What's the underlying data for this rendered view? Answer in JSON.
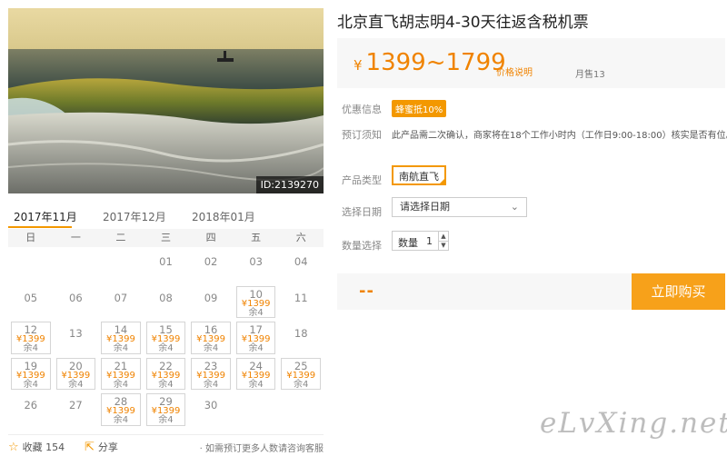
{
  "photo": {
    "id_label": "ID:2139270"
  },
  "calendar": {
    "tabs": [
      "2017年11月",
      "2017年12月",
      "2018年01月"
    ],
    "weekdays": [
      "日",
      "一",
      "二",
      "三",
      "四",
      "五",
      "六"
    ],
    "cells": [
      null,
      null,
      null,
      {
        "day": "01"
      },
      {
        "day": "02"
      },
      {
        "day": "03"
      },
      {
        "day": "04"
      },
      {
        "day": "05"
      },
      {
        "day": "06"
      },
      {
        "day": "07"
      },
      {
        "day": "08"
      },
      {
        "day": "09"
      },
      {
        "day": "10",
        "price": "¥1399",
        "rem": "余4"
      },
      {
        "day": "11"
      },
      {
        "day": "12",
        "price": "¥1399",
        "rem": "余4"
      },
      {
        "day": "13"
      },
      {
        "day": "14",
        "price": "¥1399",
        "rem": "余4"
      },
      {
        "day": "15",
        "price": "¥1399",
        "rem": "余4"
      },
      {
        "day": "16",
        "price": "¥1399",
        "rem": "余4"
      },
      {
        "day": "17",
        "price": "¥1399",
        "rem": "余4"
      },
      {
        "day": "18"
      },
      {
        "day": "19",
        "price": "¥1399",
        "rem": "余4"
      },
      {
        "day": "20",
        "price": "¥1399",
        "rem": "余4"
      },
      {
        "day": "21",
        "price": "¥1399",
        "rem": "余4"
      },
      {
        "day": "22",
        "price": "¥1399",
        "rem": "余4"
      },
      {
        "day": "23",
        "price": "¥1399",
        "rem": "余4"
      },
      {
        "day": "24",
        "price": "¥1399",
        "rem": "余4"
      },
      {
        "day": "25",
        "price": "¥1399",
        "rem": "余4"
      },
      {
        "day": "26"
      },
      {
        "day": "27"
      },
      {
        "day": "28",
        "price": "¥1399",
        "rem": "余4"
      },
      {
        "day": "29",
        "price": "¥1399",
        "rem": "余4"
      },
      {
        "day": "30"
      }
    ]
  },
  "footer": {
    "fav_label": "收藏",
    "fav_count": "154",
    "share_label": "分享",
    "help_text": "如需预订更多人数请咨询客服"
  },
  "product": {
    "title": "北京直飞胡志明4-30天往返含税机票",
    "currency": "¥",
    "price_range": "1399~1799",
    "price_note": "价格说明",
    "sold": "月售13",
    "discount_label": "优惠信息",
    "discount_badge": "蜂蜜抵10%",
    "notice_label": "预订须知",
    "notice_text": "此产品需二次确认，商家将在18个工作小时内（工作日9:00-18:00）核实是否有位。",
    "type_label": "产品类型",
    "type_value": "南航直飞",
    "date_label": "选择日期",
    "date_placeholder": "请选择日期",
    "qty_label": "数量选择",
    "qty_inner_label": "数量",
    "qty_value": "1",
    "total": "--",
    "buy_label": "立即购买"
  },
  "watermark": "eLvXing.net",
  "colors": {
    "accent": "#f39800",
    "price": "#f08300"
  }
}
